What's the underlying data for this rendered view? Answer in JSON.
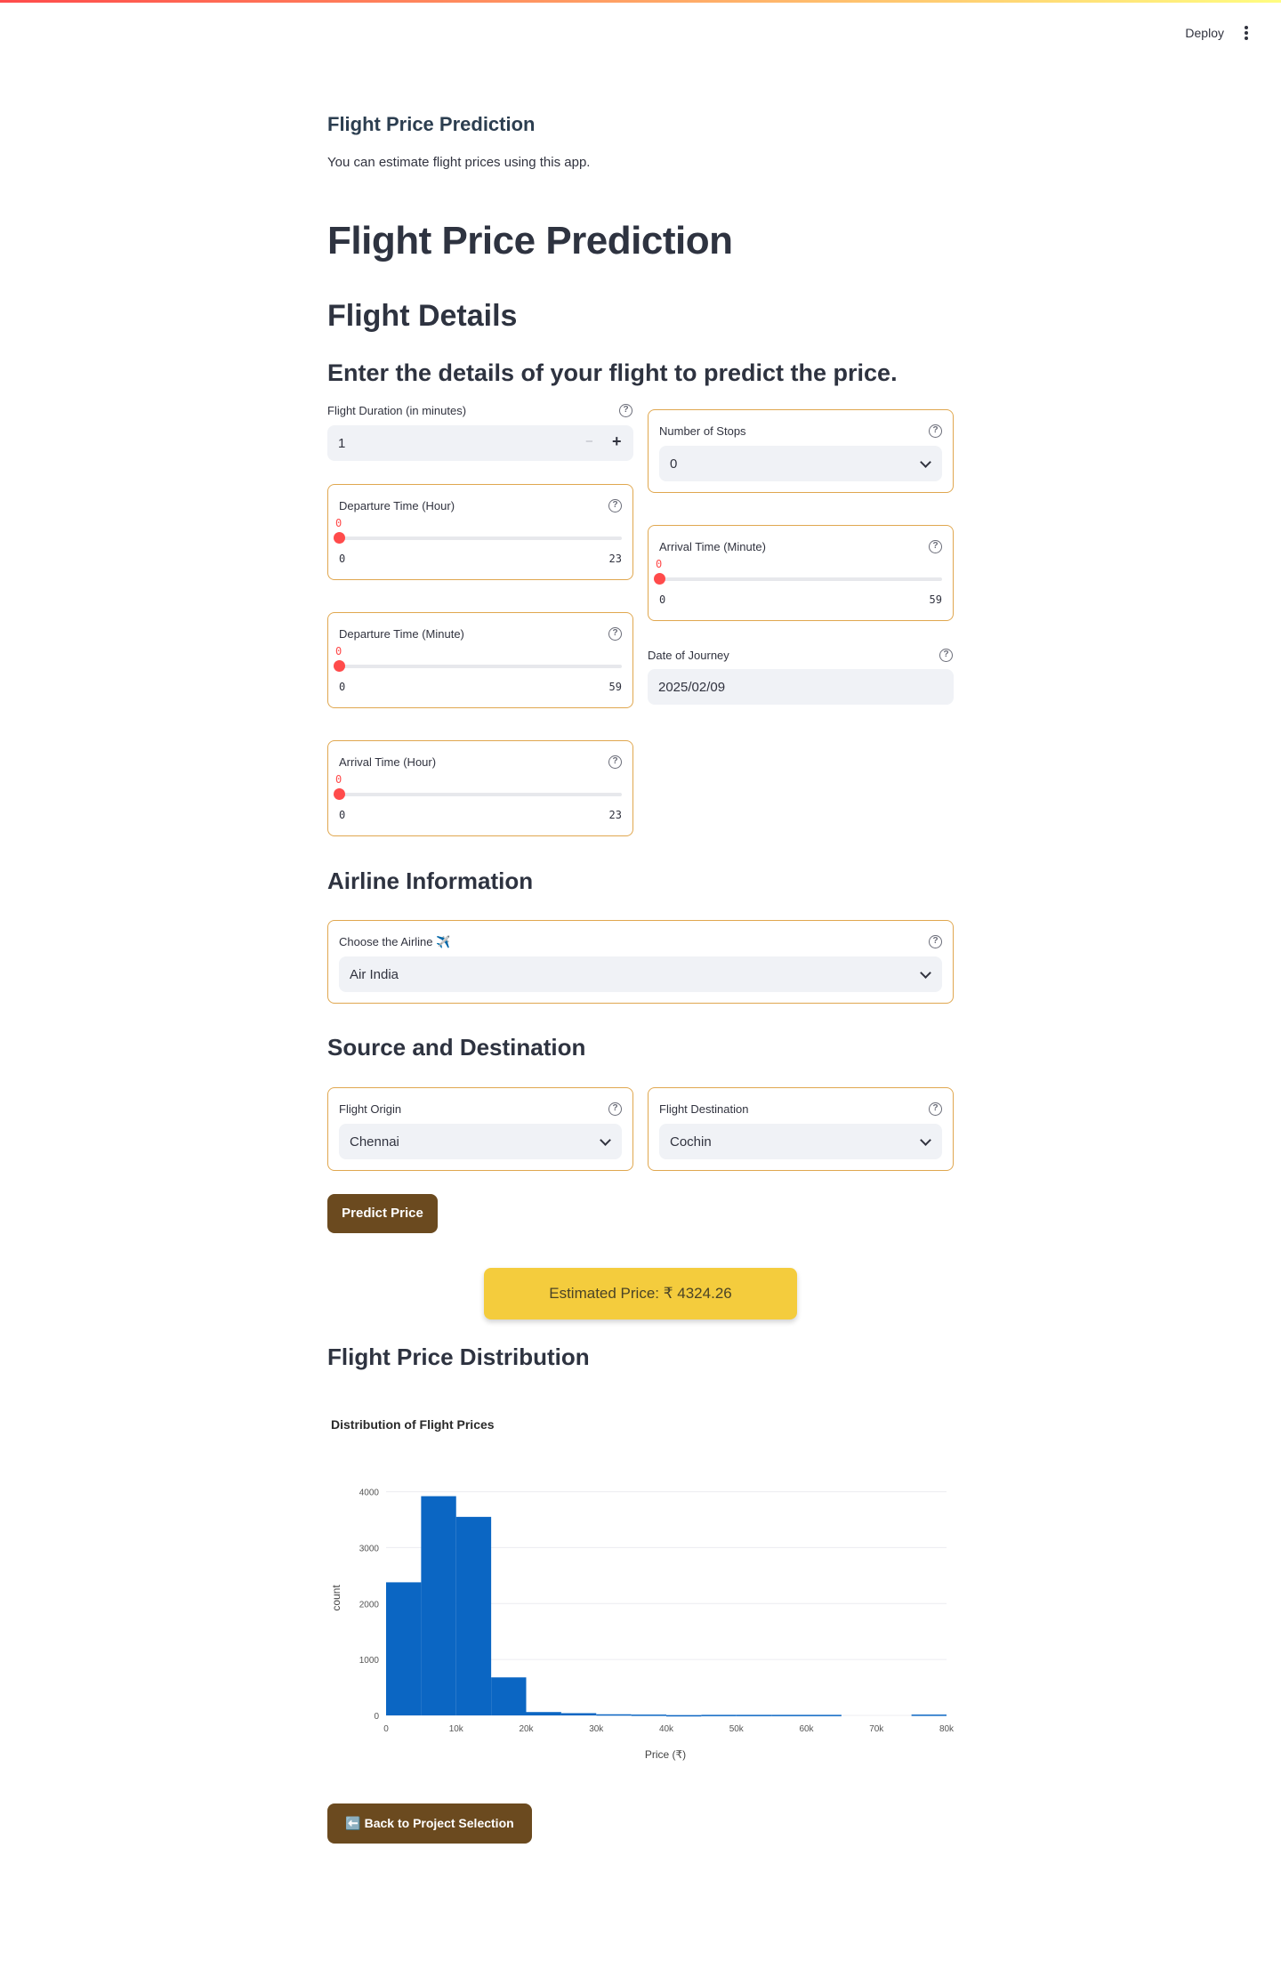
{
  "header": {
    "deploy_label": "Deploy",
    "menu_icon": "kebab-menu-icon"
  },
  "page": {
    "app_title": "Flight Price Prediction",
    "app_caption": "You can estimate flight prices using this app.",
    "main_title": "Flight Price Prediction",
    "flight_details_heading": "Flight Details",
    "instruction": "Enter the details of your flight to predict the price.",
    "airline_heading": "Airline Information",
    "route_heading": "Source and Destination",
    "distribution_heading": "Flight Price Distribution"
  },
  "inputs": {
    "duration": {
      "label": "Flight Duration (in minutes)",
      "value": "1",
      "minus": "−",
      "plus": "+"
    },
    "stops": {
      "label": "Number of Stops",
      "value": "0"
    },
    "dep_hour": {
      "label": "Departure Time (Hour)",
      "value": "0",
      "min": "0",
      "max": "23",
      "fraction": 0
    },
    "arr_minute": {
      "label": "Arrival Time (Minute)",
      "value": "0",
      "min": "0",
      "max": "59",
      "fraction": 0
    },
    "dep_minute": {
      "label": "Departure Time (Minute)",
      "value": "0",
      "min": "0",
      "max": "59",
      "fraction": 0
    },
    "date": {
      "label": "Date of Journey",
      "value": "2025/02/09"
    },
    "arr_hour": {
      "label": "Arrival Time (Hour)",
      "value": "0",
      "min": "0",
      "max": "23",
      "fraction": 0
    },
    "airline": {
      "label": "Choose the Airline ✈️",
      "value": "Air India"
    },
    "origin": {
      "label": "Flight Origin",
      "value": "Chennai"
    },
    "destination": {
      "label": "Flight Destination",
      "value": "Cochin"
    }
  },
  "help_glyph": "?",
  "predict_button": "Predict Price",
  "result": "Estimated Price: ₹ 4324.26",
  "back_button": "⬅️ Back to Project Selection",
  "colors": {
    "accent_red": "#ff4b4b",
    "card_border": "#e0a74f",
    "button_brown": "#6b4a1f",
    "result_yellow": "#f4cc3d",
    "bar_blue": "#0b66c3"
  },
  "chart_data": {
    "type": "bar",
    "title": "Distribution of Flight Prices",
    "xlabel": "Price (₹)",
    "ylabel": "count",
    "xlim": [
      0,
      80000
    ],
    "ylim": [
      0,
      4200
    ],
    "x_ticks": [
      "0",
      "10k",
      "20k",
      "30k",
      "40k",
      "50k",
      "60k",
      "70k",
      "80k"
    ],
    "y_ticks": [
      "0",
      "1000",
      "2000",
      "3000",
      "4000"
    ],
    "bin_width": 5000,
    "bin_starts": [
      0,
      5000,
      10000,
      15000,
      20000,
      25000,
      30000,
      35000,
      40000,
      45000,
      50000,
      55000,
      60000,
      65000,
      70000,
      75000
    ],
    "values": [
      2380,
      3920,
      3550,
      680,
      60,
      40,
      20,
      15,
      5,
      10,
      10,
      10,
      10,
      0,
      0,
      15
    ],
    "grid": true
  }
}
